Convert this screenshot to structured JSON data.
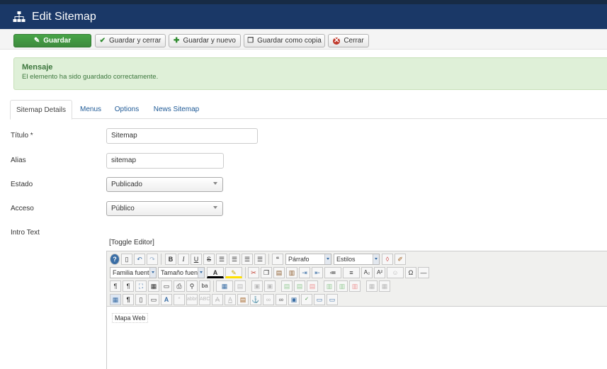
{
  "header": {
    "title": "Edit Sitemap",
    "icon": "sitemap-icon"
  },
  "toolbar": {
    "save_label": "Guardar",
    "save_close_label": "Guardar y cerrar",
    "save_new_label": "Guardar y nuevo",
    "save_copy_label": "Guardar como copia",
    "close_label": "Cerrar"
  },
  "alert": {
    "heading": "Mensaje",
    "message": "El elemento ha sido guardado correctamente."
  },
  "tabs": [
    {
      "label": "Sitemap Details",
      "active": true
    },
    {
      "label": "Menus",
      "active": false
    },
    {
      "label": "Options",
      "active": false
    },
    {
      "label": "News Sitemap",
      "active": false
    }
  ],
  "form": {
    "title": {
      "label": "Título *",
      "value": "Sitemap"
    },
    "alias": {
      "label": "Alias",
      "value": "sitemap"
    },
    "state": {
      "label": "Estado",
      "value": "Publicado"
    },
    "access": {
      "label": "Acceso",
      "value": "Público"
    },
    "intro": {
      "label": "Intro Text"
    }
  },
  "editor": {
    "toggle_label": "[Toggle Editor]",
    "format_select": "Párrafo",
    "styles_select": "Estilos",
    "font_family_select": "Familia fuente",
    "font_size_select": "Tamaño fuente",
    "content": "Mapa Web"
  },
  "colors": {
    "header_bg": "#1a3867",
    "save_green": "#47a447",
    "alert_bg": "#dff0d8",
    "alert_text": "#3c763d",
    "link": "#1f5a96"
  }
}
